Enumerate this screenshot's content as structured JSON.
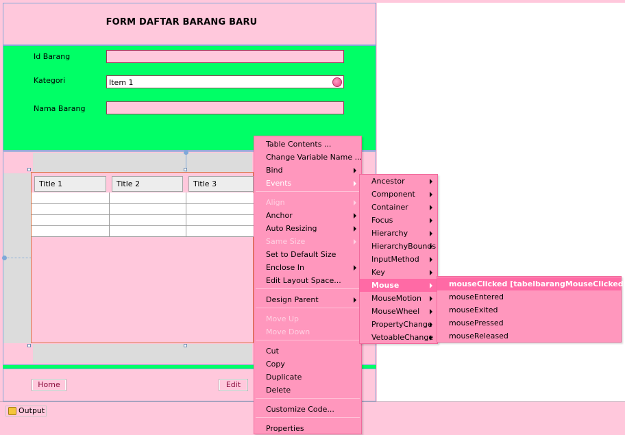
{
  "form": {
    "title": "FORM DAFTAR BARANG BARU",
    "labels": {
      "id_barang": "Id Barang",
      "kategori": "Kategori",
      "nama_barang": "Nama Barang"
    },
    "kategori_value": "Item 1"
  },
  "table": {
    "columns": [
      "Title 1",
      "Title 2",
      "Title 3"
    ]
  },
  "buttons": {
    "home": "Home",
    "edit": "Edit"
  },
  "bottom": {
    "output_tab": "Output"
  },
  "context_menu": {
    "items": {
      "table_contents": "Table Contents ...",
      "change_variable_name": "Change Variable Name ...",
      "bind": "Bind",
      "events": "Events",
      "align": "Align",
      "anchor": "Anchor",
      "auto_resizing": "Auto Resizing",
      "same_size": "Same Size",
      "set_default_size": "Set to Default Size",
      "enclose_in": "Enclose In",
      "edit_layout_space": "Edit Layout Space...",
      "design_parent": "Design Parent",
      "move_up": "Move Up",
      "move_down": "Move Down",
      "cut": "Cut",
      "copy": "Copy",
      "duplicate": "Duplicate",
      "delete": "Delete",
      "customize_code": "Customize Code...",
      "properties": "Properties"
    }
  },
  "events_menu": [
    "Ancestor",
    "Component",
    "Container",
    "Focus",
    "Hierarchy",
    "HierarchyBounds",
    "InputMethod",
    "Key",
    "Mouse",
    "MouseMotion",
    "MouseWheel",
    "PropertyChange",
    "VetoableChange"
  ],
  "mouse_menu": [
    "mouseClicked [tabelbarangMouseClicked]",
    "mouseEntered",
    "mouseExited",
    "mousePressed",
    "mouseReleased"
  ]
}
